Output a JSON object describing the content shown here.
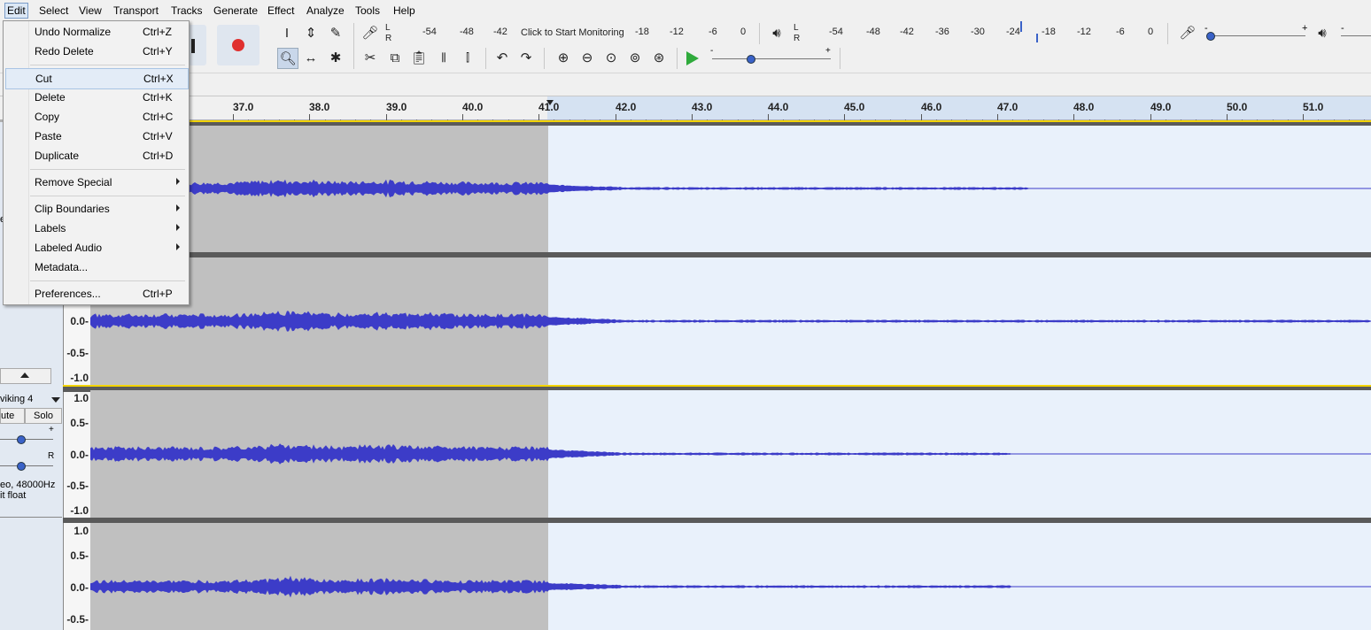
{
  "menubar": {
    "items": [
      "Edit",
      "Select",
      "View",
      "Transport",
      "Tracks",
      "Generate",
      "Effect",
      "Analyze",
      "Tools",
      "Help"
    ]
  },
  "edit_menu": {
    "items": [
      {
        "label": "Undo Normalize",
        "shortcut": "Ctrl+Z"
      },
      {
        "label": "Redo Delete",
        "shortcut": "Ctrl+Y"
      },
      {
        "label": "Cut",
        "shortcut": "Ctrl+X"
      },
      {
        "label": "Delete",
        "shortcut": "Ctrl+K"
      },
      {
        "label": "Copy",
        "shortcut": "Ctrl+C"
      },
      {
        "label": "Paste",
        "shortcut": "Ctrl+V"
      },
      {
        "label": "Duplicate",
        "shortcut": "Ctrl+D"
      },
      {
        "label": "Remove Special",
        "shortcut": ""
      },
      {
        "label": "Clip Boundaries",
        "shortcut": ""
      },
      {
        "label": "Labels",
        "shortcut": ""
      },
      {
        "label": "Labeled Audio",
        "shortcut": ""
      },
      {
        "label": "Metadata...",
        "shortcut": ""
      },
      {
        "label": "Preferences...",
        "shortcut": "Ctrl+P"
      }
    ]
  },
  "recording_meter": {
    "channels": [
      "L",
      "R"
    ],
    "ticks": [
      "-54",
      "-48",
      "-42",
      "-18",
      "-12",
      "-6",
      "0"
    ],
    "prompt": "Click to Start Monitoring"
  },
  "playback_meter": {
    "channels": [
      "L",
      "R"
    ],
    "ticks": [
      "-54",
      "-48",
      "-42",
      "-36",
      "-30",
      "-24",
      "-18",
      "-12",
      "-6",
      "0"
    ]
  },
  "mixer": {
    "minus": "-",
    "plus": "+"
  },
  "ruler": {
    "labels": [
      "37.0",
      "38.0",
      "39.0",
      "40.0",
      "41.0",
      "42.0",
      "43.0",
      "44.0",
      "45.0",
      "46.0",
      "47.0",
      "48.0",
      "49.0",
      "50.0",
      "51.0"
    ]
  },
  "track1": {
    "scale": [
      "0.0-",
      "-0.5-",
      "-1.0"
    ]
  },
  "track2": {
    "name": "viking 4",
    "mute": "ute",
    "solo": "Solo",
    "gain_plus": "+",
    "pan_right": "R",
    "info_line1": "eo, 48000Hz",
    "info_line2": "it float",
    "fragment": "e",
    "scale_top": [
      "1.0",
      "0.5-",
      "0.0-",
      "-0.5-",
      "-1.0"
    ],
    "scale_bottom": [
      "1.0",
      "0.5-",
      "0.0-",
      "-0.5-"
    ]
  },
  "colors": {
    "waveform": "#3c3cc8",
    "selection": "#c0c0c0",
    "background": "#e9f1fb",
    "record": "#e0302f",
    "play": "#2faa3c"
  }
}
